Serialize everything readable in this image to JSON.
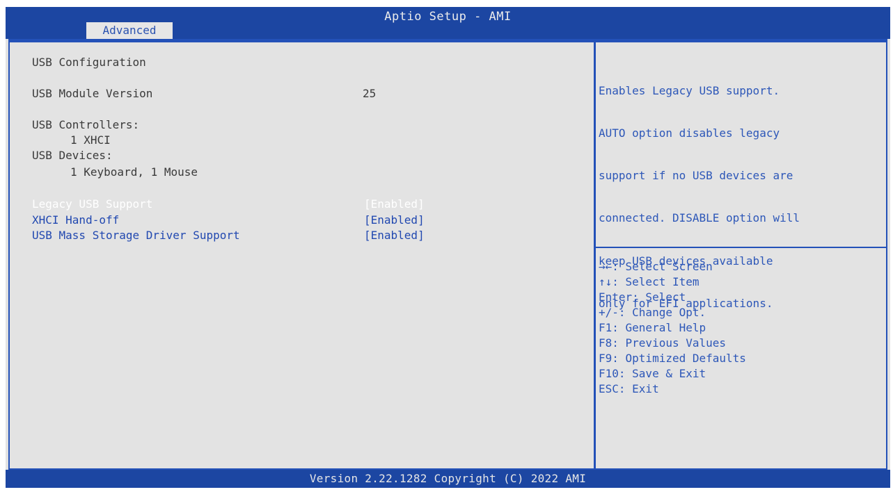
{
  "header": {
    "title": "Aptio Setup - AMI",
    "active_tab": "Advanced"
  },
  "main": {
    "section_title": "USB Configuration",
    "module_version_label": "USB Module Version",
    "module_version_value": "25",
    "controllers_label": "USB Controllers:",
    "controllers_value": "1 XHCI",
    "devices_label": "USB Devices:",
    "devices_value": "1 Keyboard, 1 Mouse",
    "options": [
      {
        "label": "Legacy USB Support",
        "value": "[Enabled]"
      },
      {
        "label": "XHCI Hand-off",
        "value": "[Enabled]"
      },
      {
        "label": "USB Mass Storage Driver Support",
        "value": "[Enabled]"
      }
    ]
  },
  "help_panel": {
    "lines": [
      "Enables Legacy USB support.",
      "AUTO option disables legacy",
      "support if no USB devices are",
      "connected. DISABLE option will",
      "keep USB devices available",
      "only for EFI applications."
    ]
  },
  "key_legend": [
    "→←: Select Screen",
    "↑↓: Select Item",
    "Enter: Select",
    "+/-: Change Opt.",
    "F1: General Help",
    "F8: Previous Values",
    "F9: Optimized Defaults",
    "F10: Save & Exit",
    "ESC: Exit"
  ],
  "footer": {
    "version_text": "Version 2.22.1282 Copyright (C) 2022 AMI"
  },
  "colors": {
    "bar_blue": "#1c46a2",
    "panel_gray": "#e3e3e3",
    "option_blue": "#2148b0",
    "help_blue": "#2d57b8"
  }
}
